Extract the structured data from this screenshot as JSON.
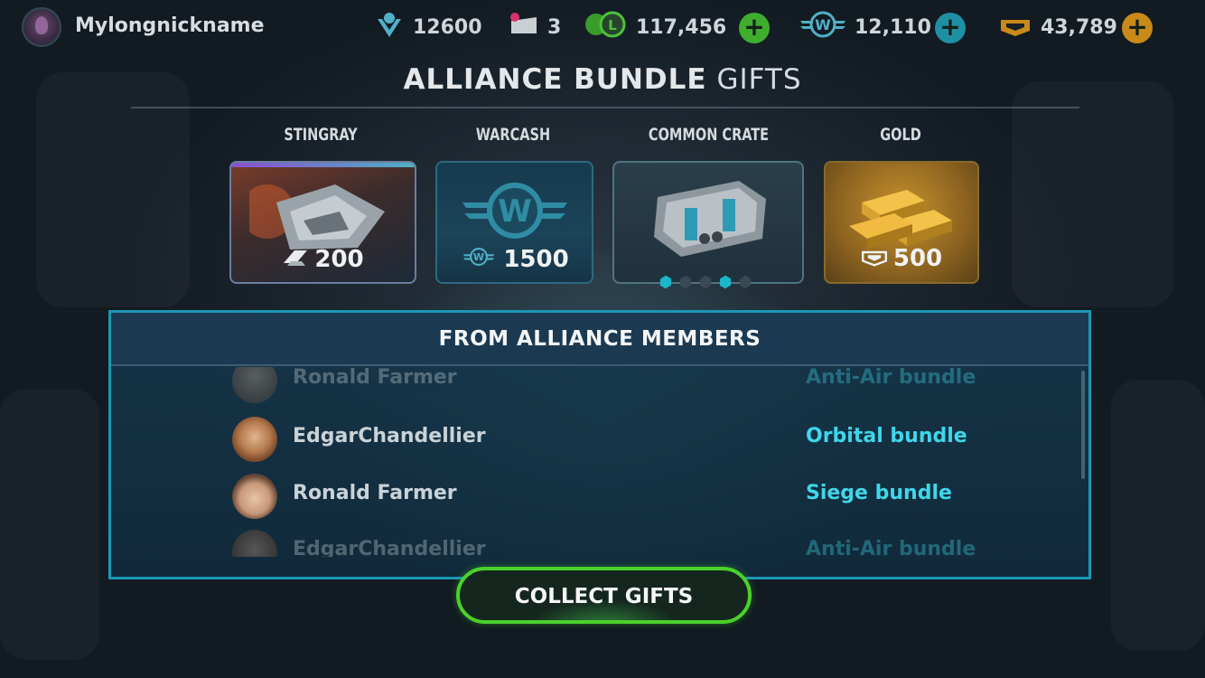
{
  "player": {
    "nickname": "Mylongnickname"
  },
  "resources": [
    {
      "id": "rank",
      "value": "12600",
      "icon": "rank-icon",
      "has_plus": false
    },
    {
      "id": "tickets",
      "value": "3",
      "icon": "ticket-icon",
      "has_plus": false
    },
    {
      "id": "lc",
      "value": "117,456",
      "icon": "credits-icon",
      "has_plus": true,
      "plus_color": "#3fae2e"
    },
    {
      "id": "warcash",
      "value": "12,110",
      "icon": "warcash-icon",
      "has_plus": true,
      "plus_color": "#1f8fa3"
    },
    {
      "id": "gold",
      "value": "43,789",
      "icon": "gold-icon",
      "has_plus": true,
      "plus_color": "#c88a18"
    }
  ],
  "title": {
    "bold": "ALLIANCE BUNDLE",
    "thin": "GIFTS"
  },
  "gifts": [
    {
      "label": "STINGRAY",
      "amount": "200",
      "icon": "shard-icon"
    },
    {
      "label": "WARCASH",
      "amount": "1500",
      "icon": "warcash-icon"
    },
    {
      "label": "COMMON CRATE",
      "amount": "",
      "icon": "crate-icon"
    },
    {
      "label": "GOLD",
      "amount": "500",
      "icon": "gold-icon"
    }
  ],
  "crate_pager": {
    "total": 5,
    "active": [
      0,
      3
    ]
  },
  "panel": {
    "title": "FROM ALLIANCE MEMBERS",
    "rows": [
      {
        "name": "Ronald Farmer",
        "bundle": "Anti-Air bundle"
      },
      {
        "name": "EdgarChandellier",
        "bundle": "Orbital bundle"
      },
      {
        "name": "Ronald Farmer",
        "bundle": "Siege bundle"
      },
      {
        "name": "EdgarChandellier",
        "bundle": "Anti-Air bundle"
      }
    ]
  },
  "collect_button": "COLLECT GIFTS",
  "colors": {
    "accent": "#1b97b6",
    "bundle_text": "#3fd6ea",
    "collect_border": "#4bd12b"
  }
}
